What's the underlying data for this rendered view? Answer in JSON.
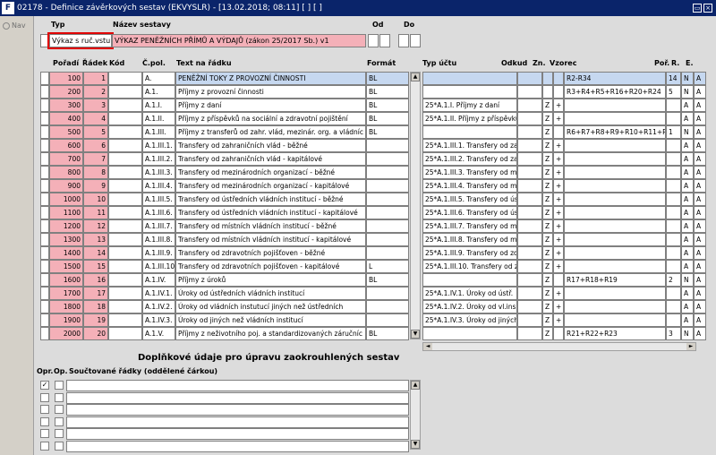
{
  "window": {
    "title": "02178 - Definice závěrkových sestav (EKVYSLR) - [13.02.2018; 08:11]  [ ] [ ]",
    "logo": "F",
    "restore_symbol": "▭",
    "close_symbol": "×"
  },
  "nav": {
    "label": "Nav"
  },
  "header": {
    "typ_label": "Typ",
    "nazev_label": "Název sestavy",
    "od_label": "Od",
    "do_label": "Do",
    "typ_value": "Výkaz s ruč.vstu",
    "nazev_value": "VÝKAZ PENĚŽNÍCH PŘÍMŮ A VÝDAJŮ (zákon 25/2017 Sb.) v1"
  },
  "grid_left": {
    "headers": {
      "poradi": "Pořadí",
      "radek": "Řádek",
      "kod": "Kód",
      "cpol": "Č.pol.",
      "text": "Text na řádku",
      "format": "Formát"
    },
    "rows": [
      {
        "poradi": "100",
        "radek": "1",
        "cpol": "A.",
        "text": "PENĚŽNÍ TOKY Z PROVOZNÍ ČINNOSTI",
        "format": "BL"
      },
      {
        "poradi": "200",
        "radek": "2",
        "cpol": "A.1.",
        "text": "Příjmy z provozní činnosti",
        "format": "BL"
      },
      {
        "poradi": "300",
        "radek": "3",
        "cpol": "A.1.I.",
        "text": "Příjmy z daní",
        "format": "BL"
      },
      {
        "poradi": "400",
        "radek": "4",
        "cpol": "A.1.II.",
        "text": "Příjmy z příspěvků na sociální a zdravotní pojištění",
        "format": "BL"
      },
      {
        "poradi": "500",
        "radek": "5",
        "cpol": "A.1.III.",
        "text": "Příjmy z transferů od zahr. vlád, mezinár. org. a vládníc",
        "format": "BL"
      },
      {
        "poradi": "600",
        "radek": "6",
        "cpol": "A.1.III.1.",
        "text": "Transfery od zahraničních vlád - běžné",
        "format": ""
      },
      {
        "poradi": "700",
        "radek": "7",
        "cpol": "A.1.III.2.",
        "text": "Transfery od zahraničních vlád - kapitálové",
        "format": ""
      },
      {
        "poradi": "800",
        "radek": "8",
        "cpol": "A.1.III.3.",
        "text": "Transfery od mezinárodních organizací - běžné",
        "format": ""
      },
      {
        "poradi": "900",
        "radek": "9",
        "cpol": "A.1.III.4.",
        "text": "Transfery od mezinárodních organizací - kapitálové",
        "format": ""
      },
      {
        "poradi": "1000",
        "radek": "10",
        "cpol": "A.1.III.5.",
        "text": "Transfery od ústředních vládních institucí - běžné",
        "format": ""
      },
      {
        "poradi": "1100",
        "radek": "11",
        "cpol": "A.1.III.6.",
        "text": "Transfery od ústředních vládních institucí - kapitálové",
        "format": ""
      },
      {
        "poradi": "1200",
        "radek": "12",
        "cpol": "A.1.III.7.",
        "text": "Transfery od místních vládních institucí - běžné",
        "format": ""
      },
      {
        "poradi": "1300",
        "radek": "13",
        "cpol": "A.1.III.8.",
        "text": "Transfery od místních vládních institucí - kapitálové",
        "format": ""
      },
      {
        "poradi": "1400",
        "radek": "14",
        "cpol": "A.1.III.9.",
        "text": "Transfery od zdravotních pojišťoven - běžné",
        "format": ""
      },
      {
        "poradi": "1500",
        "radek": "15",
        "cpol": "A.1.III.10.",
        "text": "Transfery od zdravotních pojišťoven - kapitálové",
        "format": "L"
      },
      {
        "poradi": "1600",
        "radek": "16",
        "cpol": "A.1.IV.",
        "text": "Příjmy z úroků",
        "format": "BL"
      },
      {
        "poradi": "1700",
        "radek": "17",
        "cpol": "A.1.IV.1.",
        "text": "Úroky od ústředních vládních institucí",
        "format": ""
      },
      {
        "poradi": "1800",
        "radek": "18",
        "cpol": "A.1.IV.2.",
        "text": "Úroky od vládních instutucí jiných než ústředních",
        "format": ""
      },
      {
        "poradi": "1900",
        "radek": "19",
        "cpol": "A.1.IV.3.",
        "text": "Úroky od jiných než vládních institucí",
        "format": ""
      },
      {
        "poradi": "2000",
        "radek": "20",
        "cpol": "A.1.V.",
        "text": "Příjmy z neživotního poj. a standardizovaných záručníc",
        "format": "BL"
      }
    ]
  },
  "grid_right": {
    "headers": {
      "typ_uctu": "Typ účtu",
      "odkud": "Odkud",
      "zn": "Zn.",
      "vzorec": "Vzorec",
      "por": "Poř.",
      "r": "R.",
      "e": "E."
    },
    "rows": [
      {
        "typ_uctu": "",
        "odkud": "",
        "zn": "",
        "vzorec": "R2-R34",
        "por": "14",
        "r": "N",
        "e": "A"
      },
      {
        "typ_uctu": "",
        "odkud": "",
        "zn": "",
        "vzorec": "R3+R4+R5+R16+R20+R24",
        "por": "5",
        "r": "N",
        "e": "A"
      },
      {
        "typ_uctu": "25*A.1.I. Příjmy z daní",
        "odkud": "Z",
        "zn": "+",
        "vzorec": "",
        "por": "",
        "r": "A",
        "e": "A"
      },
      {
        "typ_uctu": "25*A.1.II. Příjmy z příspěvků",
        "odkud": "Z",
        "zn": "+",
        "vzorec": "",
        "por": "",
        "r": "A",
        "e": "A"
      },
      {
        "typ_uctu": "",
        "odkud": "Z",
        "zn": "",
        "vzorec": "R6+R7+R8+R9+R10+R11+R1",
        "por": "1",
        "r": "N",
        "e": "A"
      },
      {
        "typ_uctu": "25*A.1.III.1. Transfery od zahr",
        "odkud": "Z",
        "zn": "+",
        "vzorec": "",
        "por": "",
        "r": "A",
        "e": "A"
      },
      {
        "typ_uctu": "25*A.1.III.2. Transfery od zahr",
        "odkud": "Z",
        "zn": "+",
        "vzorec": "",
        "por": "",
        "r": "A",
        "e": "A"
      },
      {
        "typ_uctu": "25*A.1.III.3. Transfery od mezi",
        "odkud": "Z",
        "zn": "+",
        "vzorec": "",
        "por": "",
        "r": "A",
        "e": "A"
      },
      {
        "typ_uctu": "25*A.1.III.4. Transfery od mezi",
        "odkud": "Z",
        "zn": "+",
        "vzorec": "",
        "por": "",
        "r": "A",
        "e": "A"
      },
      {
        "typ_uctu": "25*A.1.III.5. Transfery od ústř",
        "odkud": "Z",
        "zn": "+",
        "vzorec": "",
        "por": "",
        "r": "A",
        "e": "A"
      },
      {
        "typ_uctu": "25*A.1.III.6. Transfery od ústř",
        "odkud": "Z",
        "zn": "+",
        "vzorec": "",
        "por": "",
        "r": "A",
        "e": "A"
      },
      {
        "typ_uctu": "25*A.1.III.7. Transfery od míst",
        "odkud": "Z",
        "zn": "+",
        "vzorec": "",
        "por": "",
        "r": "A",
        "e": "A"
      },
      {
        "typ_uctu": "25*A.1.III.8. Transfery od míst",
        "odkud": "Z",
        "zn": "+",
        "vzorec": "",
        "por": "",
        "r": "A",
        "e": "A"
      },
      {
        "typ_uctu": "25*A.1.III.9. Transfery od zdra",
        "odkud": "Z",
        "zn": "+",
        "vzorec": "",
        "por": "",
        "r": "A",
        "e": "A"
      },
      {
        "typ_uctu": "25*A.1.III.10. Transfery od zdr",
        "odkud": "Z",
        "zn": "+",
        "vzorec": "",
        "por": "",
        "r": "A",
        "e": "A"
      },
      {
        "typ_uctu": "",
        "odkud": "Z",
        "zn": "",
        "vzorec": "R17+R18+R19",
        "por": "2",
        "r": "N",
        "e": "A"
      },
      {
        "typ_uctu": "25*A.1.IV.1. Úroky od ústř.",
        "odkud": "Z",
        "zn": "+",
        "vzorec": "",
        "por": "",
        "r": "A",
        "e": "A"
      },
      {
        "typ_uctu": "25*A.1.IV.2. Úroky od vl.ins",
        "odkud": "Z",
        "zn": "+",
        "vzorec": "",
        "por": "",
        "r": "A",
        "e": "A"
      },
      {
        "typ_uctu": "25*A.1.IV.3. Úroky od jiných",
        "odkud": "Z",
        "zn": "+",
        "vzorec": "",
        "por": "",
        "r": "A",
        "e": "A"
      },
      {
        "typ_uctu": "",
        "odkud": "Z",
        "zn": "",
        "vzorec": "R21+R22+R23",
        "por": "3",
        "r": "N",
        "e": "A"
      }
    ]
  },
  "bottom": {
    "title": "Doplňkové údaje pro úpravu zaokrouhlených sestav",
    "headers": {
      "opr": "Opr.",
      "op": "Op.",
      "soucet": "Součtované řádky (oddělené čárkou)"
    },
    "rows": [
      {
        "opr_checked": true
      },
      {
        "opr_checked": false
      },
      {
        "opr_checked": false
      },
      {
        "opr_checked": false
      },
      {
        "opr_checked": false
      },
      {
        "opr_checked": false
      }
    ],
    "check_mark": "✓"
  },
  "scroll": {
    "up": "▲",
    "down": "▼",
    "left": "◄",
    "right": "►"
  }
}
